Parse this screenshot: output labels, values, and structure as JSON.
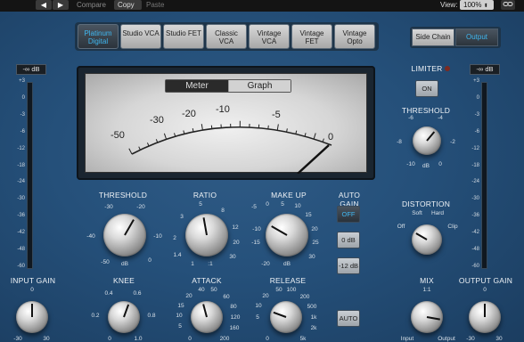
{
  "top_bar": {
    "prev": "◀",
    "next": "▶",
    "compare": "Compare",
    "copy": "Copy",
    "paste": "Paste",
    "view_label": "View:",
    "view_value": "100%",
    "link_icon": "link-icon"
  },
  "models": [
    {
      "label": "Platinum Digital",
      "active": true
    },
    {
      "label": "Studio VCA",
      "active": false
    },
    {
      "label": "Studio FET",
      "active": false
    },
    {
      "label": "Classic VCA",
      "active": false
    },
    {
      "label": "Vintage VCA",
      "active": false
    },
    {
      "label": "Vintage FET",
      "active": false
    },
    {
      "label": "Vintage Opto",
      "active": false
    }
  ],
  "sidechain": {
    "side_chain": "Side Chain",
    "output": "Output",
    "active": "Output"
  },
  "meter": {
    "tab_meter": "Meter",
    "tab_graph": "Graph",
    "active": "Meter",
    "scale": [
      "-50",
      "-30",
      "-20",
      "-10",
      "-5",
      "0"
    ],
    "needle_db": 0
  },
  "input": {
    "readout": "-∞ dB",
    "scale": [
      "+3",
      "0",
      "-3",
      "-6",
      "-12",
      "-18",
      "-24",
      "-30",
      "-36",
      "-42",
      "-48",
      "-60"
    ],
    "label": "INPUT GAIN",
    "ticks": [
      "0",
      "-30",
      "30"
    ]
  },
  "output": {
    "readout": "-∞ dB",
    "scale": [
      "+3",
      "0",
      "-3",
      "-6",
      "-12",
      "-18",
      "-24",
      "-30",
      "-36",
      "-42",
      "-48",
      "-60"
    ],
    "label": "OUTPUT GAIN",
    "ticks": [
      "0",
      "-30",
      "30"
    ]
  },
  "threshold": {
    "label": "THRESHOLD",
    "ticks": [
      "-30",
      "-20",
      "-10",
      "0",
      "-40",
      "-50"
    ],
    "unit": "dB"
  },
  "ratio": {
    "label": "RATIO",
    "ticks": [
      "5",
      "8",
      "12",
      "20",
      "30",
      "3",
      "2",
      "1.4",
      "1"
    ],
    "unit": ":1"
  },
  "makeup": {
    "label": "MAKE UP",
    "ticks": [
      "0",
      "5",
      "10",
      "15",
      "20",
      "25",
      "30",
      "-5",
      "-10",
      "-15",
      "-20"
    ],
    "unit": "dB"
  },
  "autogain": {
    "label": "AUTO GAIN",
    "off": "OFF",
    "zero": "0 dB",
    "minus12": "-12 dB",
    "active": "OFF"
  },
  "knee": {
    "label": "KNEE",
    "ticks": [
      "0.4",
      "0.6",
      "0.2",
      "0.8",
      "0",
      "1.0"
    ]
  },
  "attack": {
    "label": "ATTACK",
    "ticks": [
      "40",
      "50",
      "20",
      "60",
      "80",
      "15",
      "10",
      "120",
      "5",
      "160",
      "0",
      "200"
    ]
  },
  "release": {
    "label": "RELEASE",
    "ticks": [
      "50",
      "100",
      "200",
      "20",
      "500",
      "10",
      "1k",
      "5",
      "2k",
      "0",
      "5k"
    ]
  },
  "auto_button": "AUTO",
  "limiter": {
    "label": "LIMITER",
    "on": "ON",
    "threshold_label": "THRESHOLD",
    "ticks": [
      "-6",
      "-4",
      "-8",
      "-2",
      "-10",
      "0"
    ],
    "unit": "dB"
  },
  "distortion": {
    "label": "DISTORTION",
    "soft": "Soft",
    "hard": "Hard",
    "off": "Off",
    "clip": "Clip"
  },
  "mix": {
    "label": "MIX",
    "ratio": "1:1",
    "input": "Input",
    "output": "Output"
  }
}
